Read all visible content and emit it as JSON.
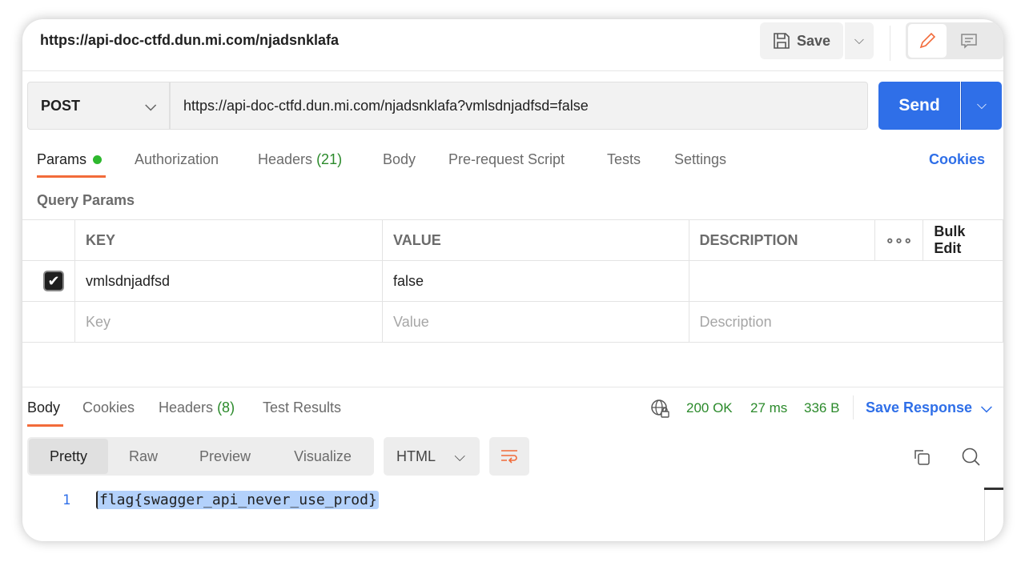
{
  "header": {
    "title": "https://api-doc-ctfd.dun.mi.com/njadsnklafa",
    "save_label": "Save"
  },
  "request": {
    "method": "POST",
    "url": "https://api-doc-ctfd.dun.mi.com/njadsnklafa?vmlsdnjadfsd=false",
    "send_label": "Send"
  },
  "tabs": [
    {
      "label": "Params"
    },
    {
      "label": "Authorization"
    },
    {
      "label": "Headers",
      "count": "(21)"
    },
    {
      "label": "Body"
    },
    {
      "label": "Pre-request Script"
    },
    {
      "label": "Tests"
    },
    {
      "label": "Settings"
    }
  ],
  "cookies_link": "Cookies",
  "query_params": {
    "title": "Query Params",
    "columns": [
      "KEY",
      "VALUE",
      "DESCRIPTION"
    ],
    "bulk_edit": "Bulk Edit",
    "rows": [
      {
        "checked": true,
        "key": "vmlsdnjadfsd",
        "value": "false",
        "description": ""
      }
    ],
    "placeholders": {
      "key": "Key",
      "value": "Value",
      "description": "Description"
    }
  },
  "response": {
    "tabs": [
      {
        "label": "Body"
      },
      {
        "label": "Cookies"
      },
      {
        "label": "Headers",
        "count": "(8)"
      },
      {
        "label": "Test Results"
      }
    ],
    "status": "200 OK",
    "time": "27 ms",
    "size": "336 B",
    "save_response": "Save Response",
    "views": [
      "Pretty",
      "Raw",
      "Preview",
      "Visualize"
    ],
    "active_view": "Pretty",
    "language": "HTML",
    "lines": [
      {
        "number": "1",
        "text": "flag{swagger_api_never_use_prod}"
      }
    ]
  },
  "colors": {
    "accent": "#2f6fe8",
    "tab_underline": "#f26b3a",
    "success": "#2b8a2b"
  }
}
